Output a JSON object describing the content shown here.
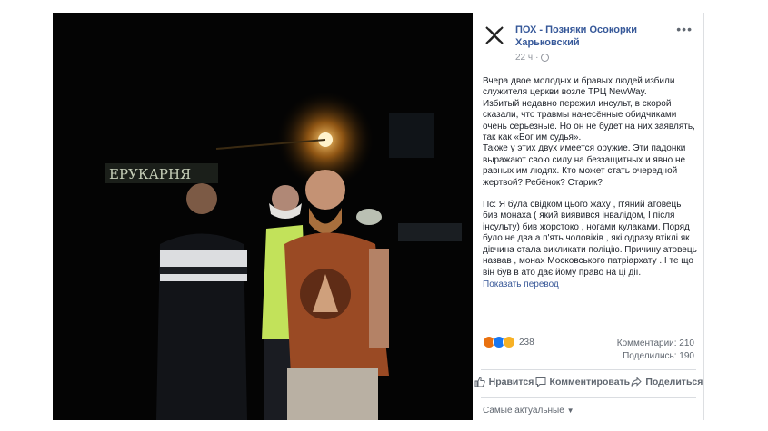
{
  "post": {
    "page_name": "ПОХ - Позняки Осокорки Харьковский",
    "timestamp": "22 ч",
    "more": "•••",
    "paragraphs": [
      "Вчера двое молодых и бравых людей избили служителя церкви возле ТРЦ NewWay.",
      "Избитый недавно пережил инсульт, в скорой сказали, что травмы нанесённые обидчиками очень серьезные. Но он не будет на них заявлять, так как «Бог им судья».",
      "Также у этих двух имеется оружие. Эти падонки выражают свою силу на беззащитных и явно не равных им людях. Кто может стать очередной жертвой? Ребёнок? Старик?"
    ],
    "paragraphs2": [
      "Пс: Я була свідком цього жаху , п'яний атовець бив монаха ( який виявився інвалідом, І після інсульту) бив жорстоко , ногами кулаками. Поряд було не два а п'ять чоловіків , які одразу втіклі як дівчина стала викликати поліцію. Причину атовець назвав , монах Московського патріархату . І те що він був в ато дає йому право на ці дії."
    ],
    "translate": "Показать перевод",
    "sign_text": "ЕРУКАРНЯ"
  },
  "stats": {
    "reactions_count": "238",
    "comments": "Комментарии: 210",
    "shares": "Поделились: 190"
  },
  "actions": {
    "like": "Нравится",
    "comment": "Комментировать",
    "share": "Поделиться"
  },
  "sort": {
    "label": "Самые актуальные"
  },
  "colors": {
    "link": "#365899",
    "angry": "#e9710f",
    "like": "#1877f2",
    "sad": "#f7b125"
  }
}
